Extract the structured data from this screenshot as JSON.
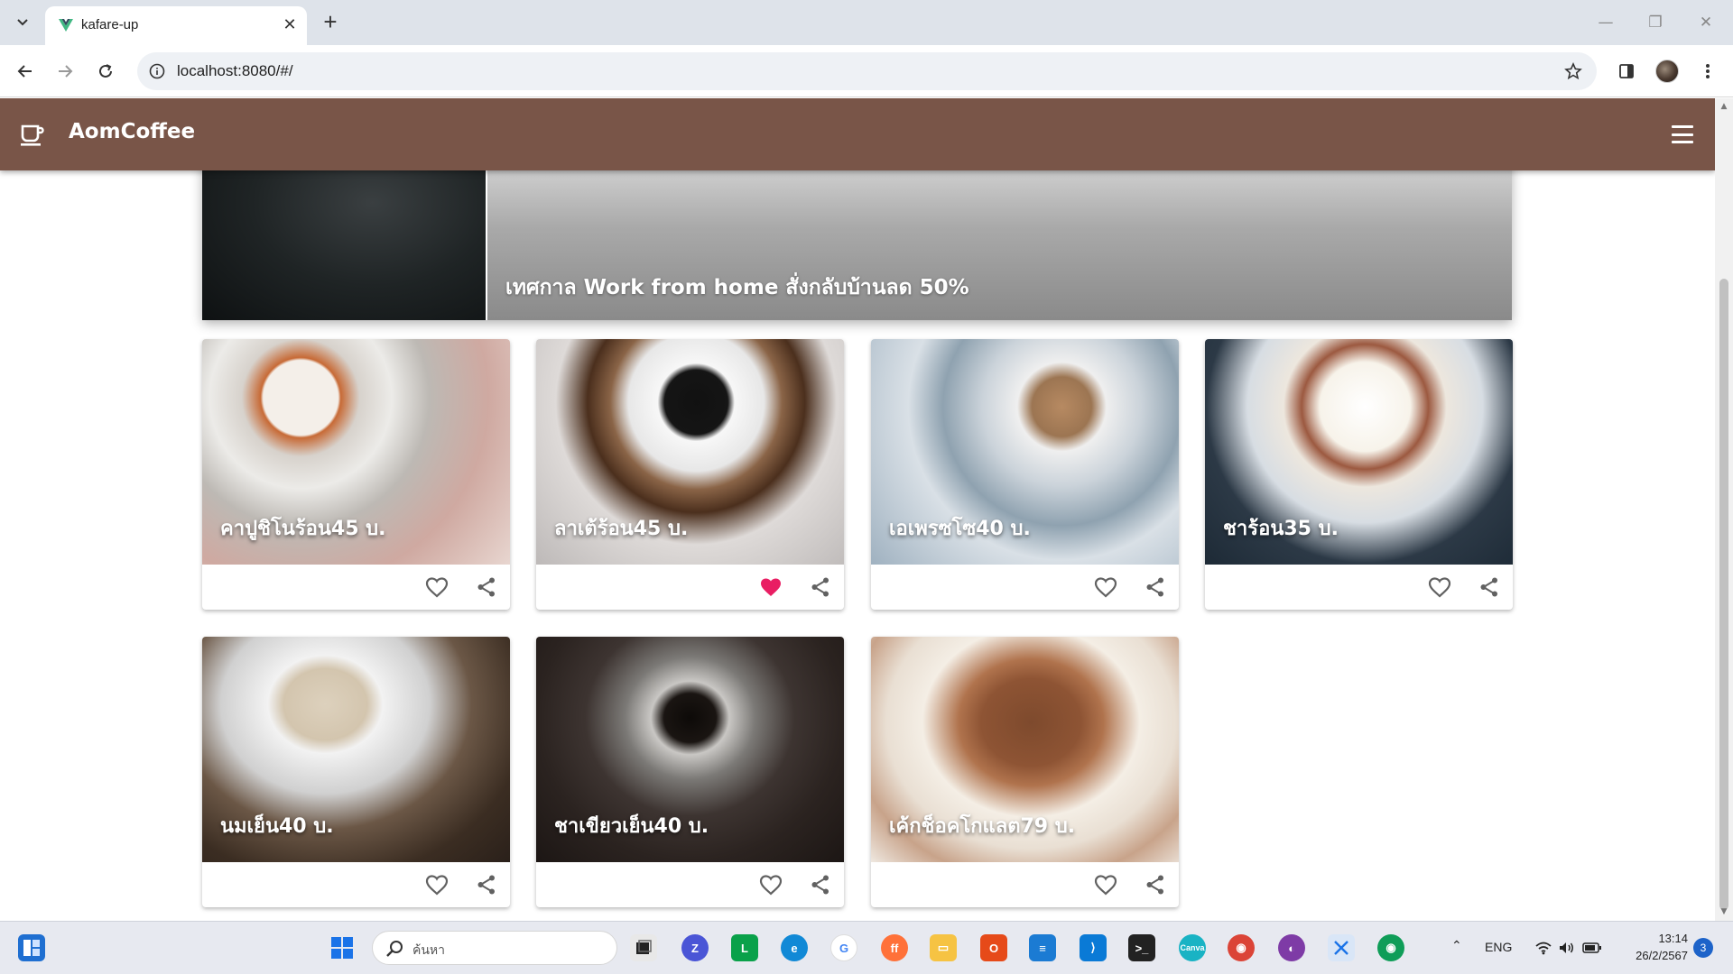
{
  "browser": {
    "tab_title": "kafare-up",
    "url": "localhost:8080/#/"
  },
  "app": {
    "title": "AomCoffee"
  },
  "banner": {
    "text": "เทศกาล Work from home สั่งกลับบ้านลด 50%"
  },
  "products": [
    {
      "name": "คาปูชิโนร้อน",
      "price": "45",
      "unit": "บ.",
      "liked": false
    },
    {
      "name": "ลาเต้ร้อน",
      "price": "45",
      "unit": "บ.",
      "liked": true
    },
    {
      "name": "เอเพรซโซ",
      "price": "40",
      "unit": "บ.",
      "liked": false
    },
    {
      "name": "ชาร้อน",
      "price": "35",
      "unit": "บ.",
      "liked": false
    },
    {
      "name": "นมเย็น",
      "price": "40",
      "unit": "บ.",
      "liked": false
    },
    {
      "name": "ชาเขียวเย็น",
      "price": "40",
      "unit": "บ.",
      "liked": false
    },
    {
      "name": "เค้กช็อคโกแลต",
      "price": "79",
      "unit": "บ.",
      "liked": false
    }
  ],
  "product_titles": [
    "คาปูชิโนร้อน45 บ.",
    "ลาเต้ร้อน45 บ.",
    "เอเพรซโซ40 บ.",
    "ชาร้อน35 บ.",
    "นมเย็น40 บ.",
    "ชาเขียวเย็น40 บ.",
    "เค้กช็อคโกแลต79 บ."
  ],
  "colors": {
    "app_bar": "#795548",
    "liked_heart": "#e91e63",
    "unliked_heart": "#616161"
  },
  "taskbar": {
    "search_placeholder": "ค้นหา",
    "language": "ENG",
    "time": "13:14",
    "date": "26/2/2567",
    "notification_count": "3",
    "apps": [
      "file-explorer-widget",
      "taskview",
      "zoom",
      "line",
      "edge",
      "google",
      "firefox",
      "folder",
      "office",
      "notepad",
      "vscode",
      "terminal",
      "canva",
      "chrome",
      "github-desktop",
      "snipping-tool",
      "chrome-active"
    ]
  }
}
